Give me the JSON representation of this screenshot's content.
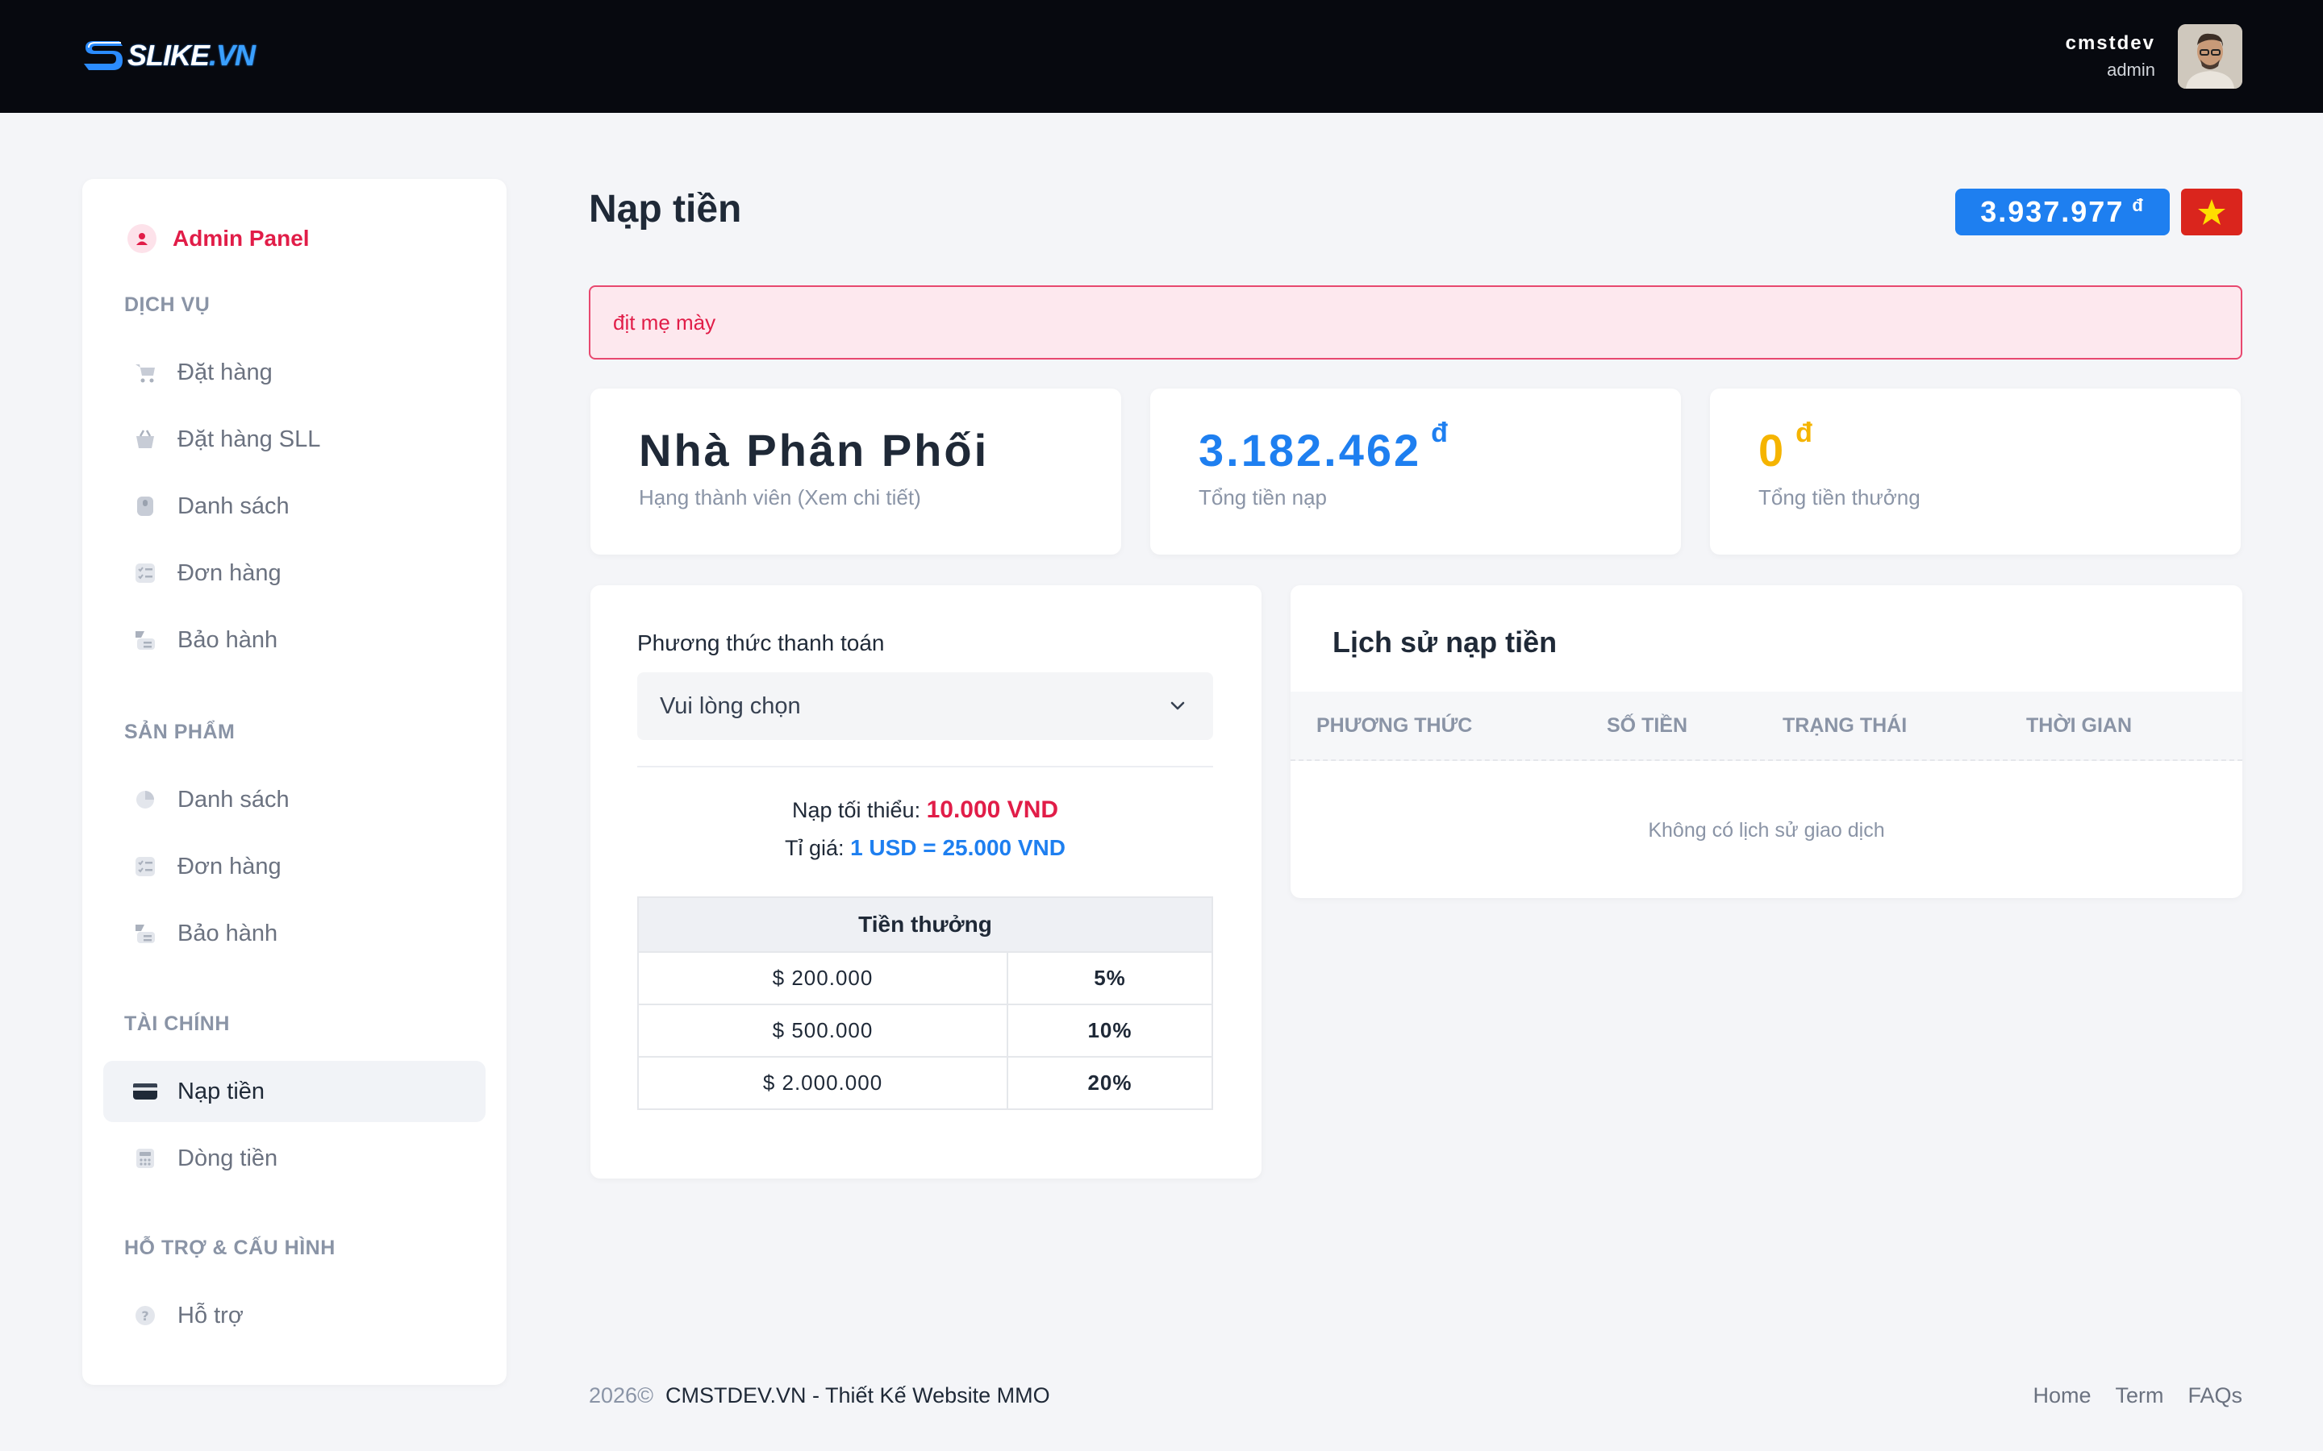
{
  "header": {
    "logo_text": "SLIKE",
    "logo_suffix": ".VN",
    "user_name": "cmstdev",
    "user_role": "admin"
  },
  "sidebar": {
    "admin_label": "Admin Panel",
    "sections": [
      {
        "title": "DỊCH VỤ",
        "items": [
          "Đặt hàng",
          "Đặt hàng SLL",
          "Danh sách",
          "Đơn hàng",
          "Bảo hành"
        ]
      },
      {
        "title": "SẢN PHẨM",
        "items": [
          "Danh sách",
          "Đơn hàng",
          "Bảo hành"
        ]
      },
      {
        "title": "TÀI CHÍNH",
        "items": [
          "Nạp tiền",
          "Dòng tiền"
        ]
      },
      {
        "title": "HỖ TRỢ & CẤU HÌNH",
        "items": [
          "Hỗ trợ"
        ]
      }
    ],
    "active_item": "Nạp tiền"
  },
  "main": {
    "page_title": "Nạp tiền",
    "balance": "3.937.977",
    "currency": "đ",
    "alert_text": "địt mẹ mày",
    "stats": [
      {
        "value": "Nhà Phân Phối",
        "label": "Hạng thành viên (Xem chi tiết)",
        "color": "#1f2937"
      },
      {
        "value": "3.182.462",
        "label": "Tổng tiền nạp",
        "color": "#1e7ff0"
      },
      {
        "value": "0",
        "label": "Tổng tiền thưởng",
        "color": "#f5b400"
      }
    ]
  },
  "payment": {
    "method_label": "Phương thức thanh toán",
    "select_placeholder": "Vui lòng chọn",
    "min_label": "Nạp tối thiểu:",
    "min_value": "10.000 VND",
    "rate_label": "Tỉ giá:",
    "rate_value": "1 USD = 25.000 VND",
    "bonus_header": "Tiền thưởng",
    "bonus_rows": [
      {
        "amount": "$ 200.000",
        "pct": "5%"
      },
      {
        "amount": "$ 500.000",
        "pct": "10%"
      },
      {
        "amount": "$ 2.000.000",
        "pct": "20%"
      }
    ]
  },
  "history": {
    "title": "Lịch sử nạp tiền",
    "columns": [
      "PHƯƠNG THỨC",
      "SỐ TIỀN",
      "TRẠNG THÁI",
      "THỜI GIAN"
    ],
    "empty_text": "Không có lịch sử giao dịch"
  },
  "footer": {
    "year": "2026©",
    "brand": "CMSTDEV.VN - Thiết Kế Website MMO",
    "links": [
      "Home",
      "Term",
      "FAQs"
    ]
  },
  "colors": {
    "accent_blue": "#1e7ff0",
    "accent_red": "#e11d48",
    "topbar": "#07090f"
  }
}
